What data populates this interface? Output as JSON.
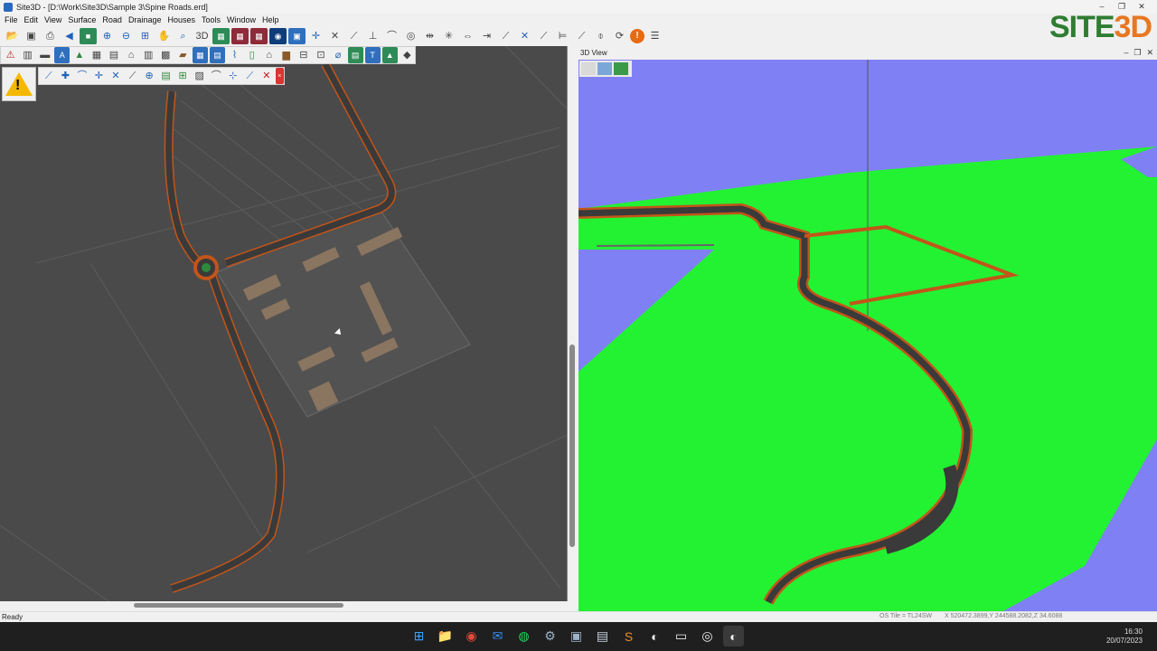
{
  "window": {
    "title": "Site3D - [D:\\Work\\Site3D\\Sample 3\\Spine Roads.erd]",
    "minimize": "–",
    "restore": "❐",
    "close": "✕"
  },
  "menu": [
    "File",
    "Edit",
    "View",
    "Surface",
    "Road",
    "Drainage",
    "Houses",
    "Tools",
    "Window",
    "Help"
  ],
  "logo": {
    "site": "SITE",
    "three_d": "3D"
  },
  "view3d": {
    "label": "3D View",
    "minimize": "–",
    "restore": "❐",
    "close": "✕"
  },
  "status": {
    "text": "Ready",
    "tile": "OS Tile = TL24SW",
    "coords": "X 520472.3899,Y 244588.2082,Z 34.6088"
  },
  "warning": {
    "glyph": "!"
  },
  "clock": {
    "time": "16:30",
    "date": "20/07/2023"
  },
  "colors": {
    "plan_background": "#4a4a4a",
    "terrain_green": "#22f232",
    "sky_blue": "#8080f5",
    "road_asphalt": "#3a3a3a",
    "road_edge": "#c2551a"
  }
}
